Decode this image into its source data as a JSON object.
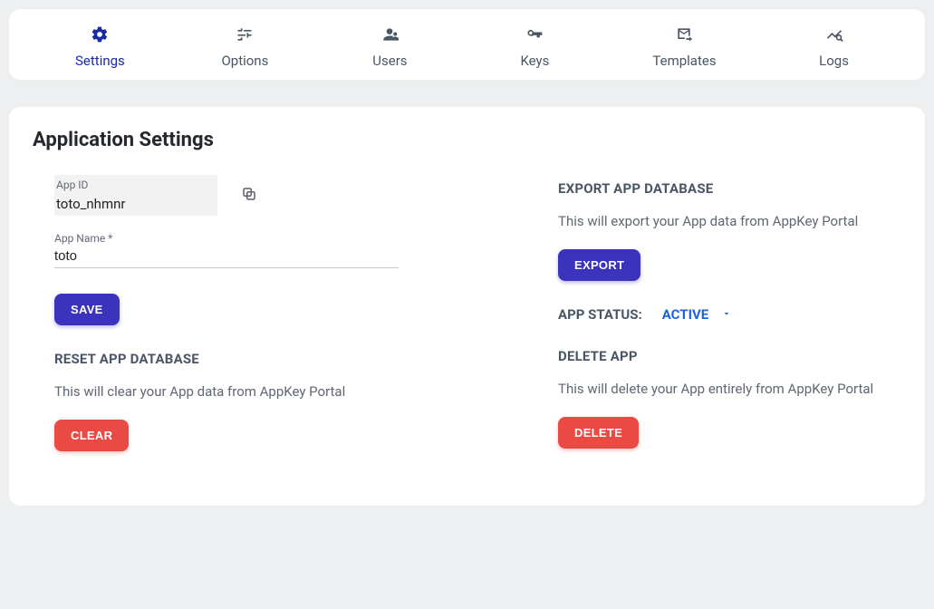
{
  "tabs": [
    {
      "label": "Settings",
      "active": true
    },
    {
      "label": "Options",
      "active": false
    },
    {
      "label": "Users",
      "active": false
    },
    {
      "label": "Keys",
      "active": false
    },
    {
      "label": "Templates",
      "active": false
    },
    {
      "label": "Logs",
      "active": false
    }
  ],
  "page_title": "Application Settings",
  "form": {
    "app_id_label": "App ID",
    "app_id_value": "toto_nhmnr",
    "app_name_label": "App Name *",
    "app_name_value": "toto",
    "save_label": "SAVE"
  },
  "reset": {
    "title": "RESET APP DATABASE",
    "desc": "This will clear your App data from AppKey Portal",
    "button": "CLEAR"
  },
  "export": {
    "title": "EXPORT APP DATABASE",
    "desc": "This will export your App data from AppKey Portal",
    "button": "EXPORT"
  },
  "status": {
    "label": "APP STATUS:",
    "value": "ACTIVE"
  },
  "del": {
    "title": "DELETE APP",
    "desc": "This will delete your App entirely from AppKey Portal",
    "button": "DELETE"
  }
}
